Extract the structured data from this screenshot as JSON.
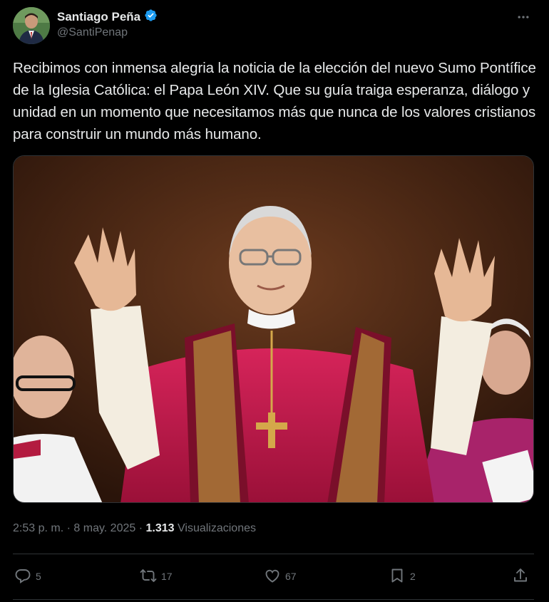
{
  "author": {
    "display_name": "Santiago Peña",
    "handle": "@SantiPenap",
    "verified": true
  },
  "tweet": {
    "text": "Recibimos con inmensa alegria la noticia de la elección del nuevo Sumo Pontífice de la Iglesia Católica: el Papa León XIV. Que su guía traiga esperanza, diálogo y unidad en un momento que necesitamos más que nunca de los valores cristianos para construir un mundo más humano."
  },
  "meta": {
    "time": "2:53 p. m.",
    "separator": "·",
    "date": "8 may. 2025",
    "views_count": "1.313",
    "views_label": "Visualizaciones"
  },
  "actions": {
    "replies": "5",
    "reposts": "17",
    "likes": "67",
    "bookmarks": "2"
  },
  "icons": [
    "verified-badge-icon",
    "more-icon",
    "reply-icon",
    "repost-icon",
    "like-icon",
    "bookmark-icon",
    "share-icon"
  ],
  "colors": {
    "background": "#000000",
    "text": "#e7e9ea",
    "muted": "#71767b",
    "verified": "#1d9bf0",
    "divider": "#2f3336"
  }
}
